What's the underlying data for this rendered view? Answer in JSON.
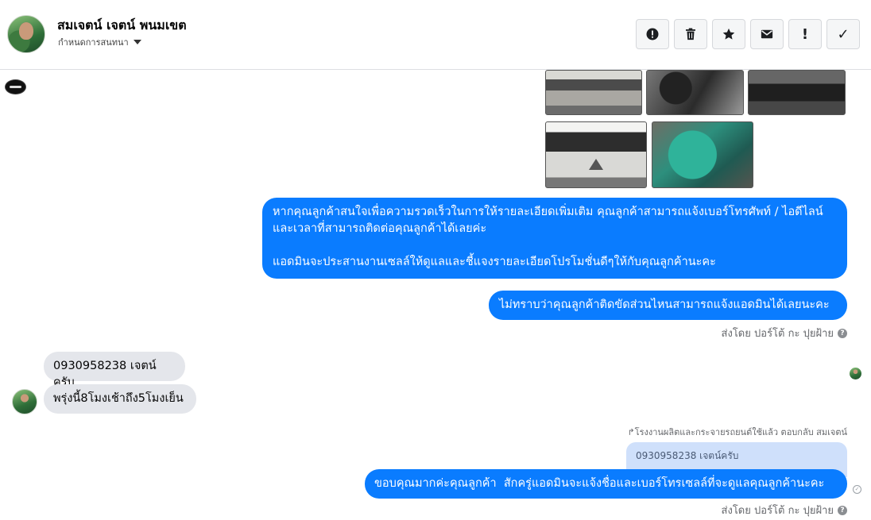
{
  "header": {
    "contact_name": "สมเจตน์ เจตน์ พนมเขต",
    "assign_label": "กำหนดการสนทนา",
    "toolbar": [
      {
        "icon": "alert-icon",
        "tooltip": ""
      },
      {
        "icon": "trash-icon",
        "tooltip": ""
      },
      {
        "icon": "star-icon",
        "tooltip": ""
      },
      {
        "icon": "envelope-icon",
        "tooltip": ""
      },
      {
        "icon": "exclamation-icon",
        "tooltip": ""
      },
      {
        "icon": "checkmark-icon",
        "tooltip": ""
      }
    ],
    "exclamation_glyph": "!",
    "check_glyph": "✓"
  },
  "messages": {
    "out_1": "หากคุณลูกค้าสนใจเพื่อความรวดเร็วในการให้รายละเอียดเพิ่มเติม คุณลูกค้าสามารถแจ้งเบอร์โทรศัพท์ / ไอดีไลน์ และเวลาที่สามารถติดต่อคุณลูกค้าได้เลยค่ะ\n\nแอดมินจะประสานงานเซลล์ให้ดูแลและชี้แจงรายละเอียดโปรโมชั่นดีๆให้กับคุณลูกค้านะคะ",
    "out_2": "ไม่ทราบว่าคุณลูกค้าติดขัดส่วนไหนสามารถแจ้งแอดมินได้เลยนะคะ",
    "sent_by_1": "ส่งโดย ปอร์โต้ กะ ปุยฝ้าย",
    "in_1": "0930958238 เจตน์ครับ",
    "in_2": "พรุ่งนี้8โมงเช้าถึง5โมงเย็น",
    "reply_meta": "↱โรงงานผลิตและกระจายรถยนต์ใช้แล้ว ตอบกลับ สมเจตน์",
    "quoted_text": "0930958238 เจตน์ครับ",
    "out_3": "ขอบคุณมากค่ะคุณลูกค้า  สักครู่แอดมินจะแจ้งชื่อและเบอร์โทรเซลล์ที่จะดูแลคุณลูกค้านะคะ",
    "sent_by_2": "ส่งโดย ปอร์โต้ กะ ปุยฝ้าย",
    "help_glyph": "?",
    "read_glyph": "✓"
  },
  "colors": {
    "outgoing_bubble": "#0a7cff",
    "incoming_bubble": "#e4e6eb",
    "quoted_bubble": "#cfe0fb"
  }
}
